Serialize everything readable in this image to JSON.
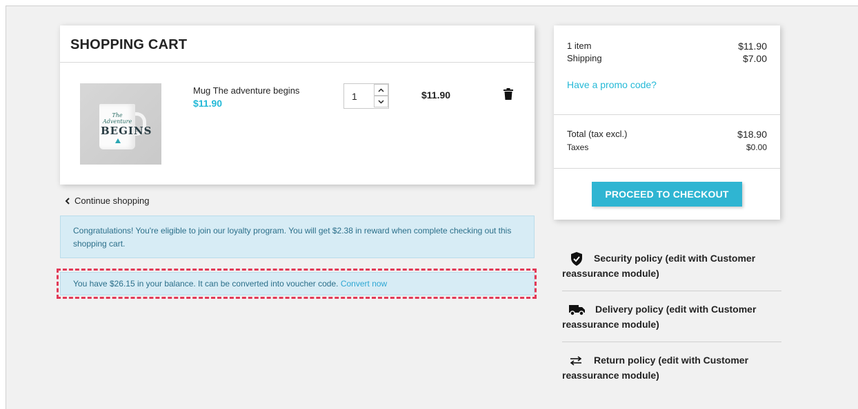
{
  "cart": {
    "title": "SHOPPING CART",
    "item": {
      "name": "Mug The adventure begins",
      "price": "$11.90",
      "quantity": "1",
      "line_total": "$11.90",
      "image_text_top": "The Adventure",
      "image_text_main": "BEGINS"
    },
    "continue_label": "Continue shopping"
  },
  "alerts": {
    "loyalty": "Congratulations! You're eligible to join our loyalty program. You will get $2.38 in reward when complete checking out this shopping cart.",
    "balance_text": "You have $26.15 in your balance. It can be converted into voucher code.",
    "convert_link": "Convert now"
  },
  "summary": {
    "items_label": "1 item",
    "items_value": "$11.90",
    "shipping_label": "Shipping",
    "shipping_value": "$7.00",
    "promo_link": "Have a promo code?",
    "total_label": "Total (tax excl.)",
    "total_value": "$18.90",
    "taxes_label": "Taxes",
    "taxes_value": "$0.00",
    "checkout_button": "PROCEED TO CHECKOUT"
  },
  "reassurance": [
    {
      "icon": "shield-check-icon",
      "label": "Security policy (edit with Customer reassurance module)"
    },
    {
      "icon": "truck-icon",
      "label": "Delivery policy (edit with Customer reassurance module)"
    },
    {
      "icon": "swap-arrows-icon",
      "label": "Return policy (edit with Customer reassurance module)"
    }
  ],
  "colors": {
    "accent": "#24b9d7",
    "button": "#2fb5d2",
    "alert_bg": "#d7ecf5",
    "highlight_border": "#e23a57"
  }
}
